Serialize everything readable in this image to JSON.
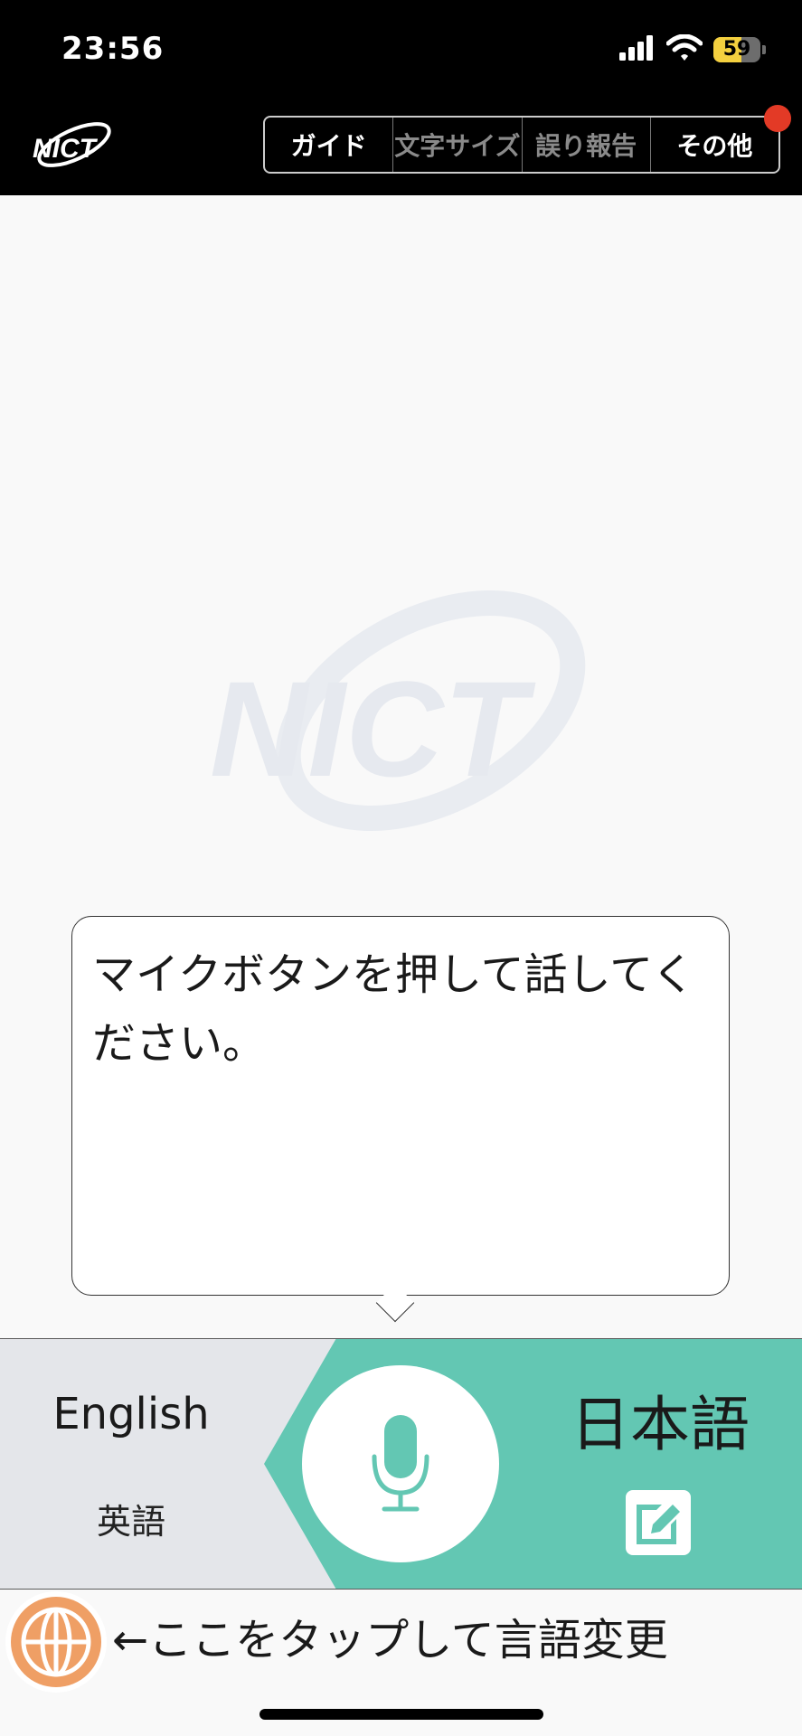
{
  "status_bar": {
    "time": "23:56",
    "battery_level": "59",
    "battery_fraction": 0.59,
    "icons": [
      "signal-icon",
      "wifi-icon",
      "battery-icon"
    ]
  },
  "header": {
    "logo_text": "NICT",
    "menu": {
      "guide": "ガイド",
      "text_size": "文字サイズ",
      "error_report": "誤り報告",
      "other": "その他"
    }
  },
  "main": {
    "watermark_text": "NICT",
    "bubble_text": "マイクボタンを押して話してください。"
  },
  "lang_bar": {
    "source_lang": "English",
    "source_lang_native": "英語",
    "target_lang": "日本語"
  },
  "footer": {
    "hint": "←ここをタップして言語変更"
  },
  "colors": {
    "teal": "#63c7b3",
    "source_bg": "#e4e6ea",
    "globe_orange": "#ef9f65",
    "notify_red": "#e33a26"
  }
}
